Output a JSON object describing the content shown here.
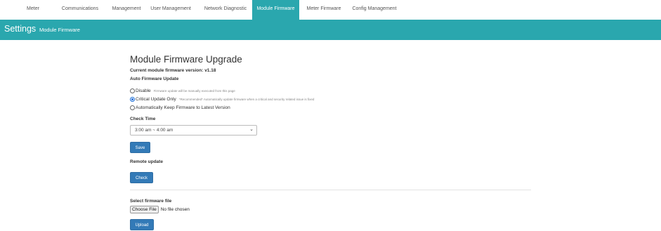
{
  "nav": {
    "tabs": [
      {
        "label": "Meter"
      },
      {
        "label": "Communications"
      },
      {
        "label": "Management"
      },
      {
        "label": "User Management"
      },
      {
        "label": "Network Diagnostic"
      },
      {
        "label": "Module Firmware"
      },
      {
        "label": "Meter Firmware"
      },
      {
        "label": "Config Management"
      }
    ],
    "active": "Module Firmware"
  },
  "banner": {
    "title": "Settings",
    "subtitle": "Module Firmware"
  },
  "page": {
    "heading": "Module Firmware Upgrade",
    "current_version": "Current module firmware version: v1.18",
    "auto_update_label": "Auto Firmware Update",
    "options": [
      {
        "label": "Disable",
        "note": "Firmware update will be manually executed from this page",
        "checked": false
      },
      {
        "label": "Critical Update Only",
        "note": "*Recommended* Automatically update firmware when a critical and security related issue is fixed",
        "checked": true
      },
      {
        "label": "Automatically Keep Firmware to Latest Version",
        "note": "",
        "checked": false
      }
    ],
    "check_time_label": "Check Time",
    "check_time_value": "3:00 am ~ 4:00 am",
    "save_label": "Save",
    "remote_update_label": "Remote update",
    "check_label": "Check",
    "select_file_label": "Select firmware file",
    "choose_file_label": "Choose File",
    "no_file_text": "No file chosen",
    "upload_label": "Upload"
  },
  "colors": {
    "accent": "#2aa7ae",
    "button": "#337ab7"
  }
}
